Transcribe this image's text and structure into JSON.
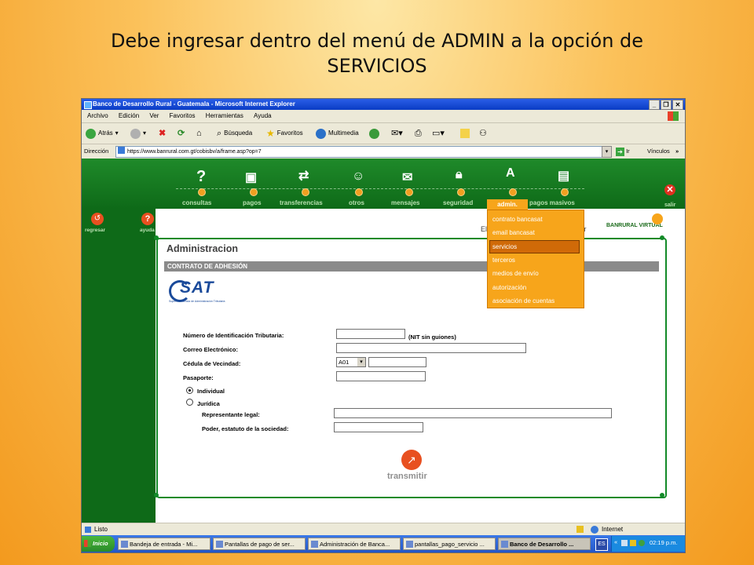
{
  "slide": {
    "title_line1": "Debe ingresar dentro del menú de ADMIN a la opción de",
    "title_line2": "SERVICIOS"
  },
  "window": {
    "title": "Banco de Desarrollo Rural - Guatemala - Microsoft Internet Explorer"
  },
  "menubar": [
    "Archivo",
    "Edición",
    "Ver",
    "Favoritos",
    "Herramientas",
    "Ayuda"
  ],
  "toolbar": {
    "back": "Atrás",
    "search": "Búsqueda",
    "favorites": "Favoritos",
    "media": "Multimedia"
  },
  "address": {
    "label": "Dirección",
    "url": "https://www.banrural.com.gt/cobisbv/a/frame.asp?op=7",
    "go": "Ir",
    "links": "Vínculos"
  },
  "nav": {
    "items": [
      "consultas",
      "pagos",
      "transferencias",
      "otros",
      "mensajes",
      "seguridad",
      "admin.",
      "pagos masivos"
    ],
    "salir": "salir",
    "regresar": "regresar",
    "ayuda": "ayuda",
    "brand": "BANRURAL VIRTUAL",
    "partial_left": "El",
    "partial_right": "cer"
  },
  "admin_menu": {
    "items": [
      "contrato bancasat",
      "email bancasat",
      "servicios",
      "terceros",
      "medios de envío",
      "autorización",
      "asociación de cuentas"
    ],
    "selected": "servicios"
  },
  "page": {
    "title": "Administracion",
    "section": "CONTRATO DE ADHESIÓN",
    "logo_text": "SAT",
    "logo_subtitle": "Superintendencia de Administración Tributaria"
  },
  "form": {
    "nit_label": "Número de Identificación Tributaria:",
    "nit_hint": "(NIT sin guiones)",
    "email_label": "Correo Electrónico:",
    "cedula_label": "Cédula de Vecindad:",
    "cedula_select": "A01",
    "pasaporte_label": "Pasaporte:",
    "radio_individual": "Individual",
    "radio_juridica": "Jurídica",
    "rep_label": "Representante legal:",
    "poder_label": "Poder, estatuto de la sociedad:",
    "submit": "transmitir"
  },
  "status": {
    "text": "Listo",
    "zone": "Internet"
  },
  "taskbar": {
    "start": "Inicio",
    "tasks": [
      "Bandeja de entrada - Mi...",
      "Pantallas de pago de ser...",
      "Administración de Banca...",
      "pantallas_pago_servicio ...",
      "Banco de Desarrollo ..."
    ],
    "lang": "ES",
    "clock": "02:19 p.m."
  },
  "colors": {
    "green": "#128a28",
    "orange": "#f7a51b",
    "accent": "#d06a08"
  }
}
